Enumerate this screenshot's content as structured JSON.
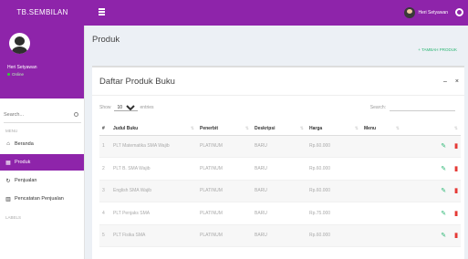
{
  "header": {
    "brand": "TB.SEMBILAN",
    "user_name": "Heri Setyawan"
  },
  "sidebar": {
    "user_name": "Heri Setyawan",
    "status": "Online",
    "search_placeholder": "Search...",
    "section_main": "MENU",
    "items": [
      {
        "label": "Beranda",
        "icon": "home-icon"
      },
      {
        "label": "Produk",
        "icon": "grid-icon",
        "active": true
      },
      {
        "label": "Penjualan",
        "icon": "history-icon"
      },
      {
        "label": "Pencatatan Penjualan",
        "icon": "chart-icon"
      }
    ],
    "section_second": "LABELS"
  },
  "page": {
    "title": "Produk",
    "add_label": "+ TAMBAH PRODUK"
  },
  "box": {
    "title": "Daftar Produk Buku",
    "minimize": "–",
    "close": "×",
    "show_label": "Show",
    "entries_value": "10",
    "entries_label": "entries",
    "search_label": "Search:"
  },
  "table": {
    "columns": [
      "#",
      "Judul Buku",
      "Penerbit",
      "Deskripsi",
      "Harga",
      "Menu"
    ],
    "rows": [
      [
        "1",
        "PLT Matematika SMA Wajib",
        "PLATINUM",
        "BARU",
        "Rp.60.000"
      ],
      [
        "2",
        "PLT B. SMA Wajib",
        "PLATINUM",
        "BARU",
        "Rp.60.000"
      ],
      [
        "3",
        "English SMA Wajib",
        "PLATINUM",
        "BARU",
        "Rp.60.000"
      ],
      [
        "4",
        "PLT Penjaks SMA",
        "PLATINUM",
        "BARU",
        "Rp.75.000"
      ],
      [
        "5",
        "PLT Fisika SMA",
        "PLATINUM",
        "BARU",
        "Rp.60.000"
      ]
    ]
  },
  "colors": {
    "brand": "#8e24aa",
    "edit": "#2bb673",
    "delete": "#e53935"
  }
}
